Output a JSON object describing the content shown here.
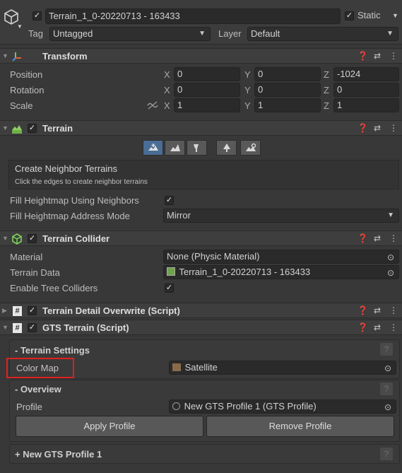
{
  "object": {
    "name": "Terrain_1_0-20220713 - 163433",
    "static_label": "Static",
    "tag_label": "Tag",
    "tag_value": "Untagged",
    "layer_label": "Layer",
    "layer_value": "Default"
  },
  "transform": {
    "title": "Transform",
    "position_label": "Position",
    "rotation_label": "Rotation",
    "scale_label": "Scale",
    "axis_x": "X",
    "axis_y": "Y",
    "axis_z": "Z",
    "position": {
      "x": "0",
      "y": "0",
      "z": "-1024"
    },
    "rotation": {
      "x": "0",
      "y": "0",
      "z": "0"
    },
    "scale": {
      "x": "1",
      "y": "1",
      "z": "1"
    }
  },
  "terrain": {
    "title": "Terrain",
    "tools": [
      "raise-lower-terrain-icon",
      "paint-terrain-icon",
      "paint-trees-icon",
      "paint-details-icon",
      "terrain-settings-icon"
    ],
    "tool_name": "Create Neighbor Terrains",
    "tool_hint": "Click the edges to create neighbor terrains",
    "fill_heightmap_label": "Fill Heightmap Using Neighbors",
    "address_mode_label": "Fill Heightmap Address Mode",
    "address_mode_value": "Mirror"
  },
  "terrain_collider": {
    "title": "Terrain Collider",
    "material_label": "Material",
    "material_value": "None (Physic Material)",
    "terrain_data_label": "Terrain Data",
    "terrain_data_value": "Terrain_1_0-20220713 - 163433",
    "tree_colliders_label": "Enable Tree Colliders"
  },
  "detail_overwrite": {
    "title": "Terrain Detail Overwrite (Script)"
  },
  "gts_terrain": {
    "title": "GTS Terrain (Script)",
    "settings_header": "- Terrain Settings",
    "color_map_label": "Color Map",
    "color_map_value": "Satellite",
    "overview_header": "- Overview",
    "profile_label": "Profile",
    "profile_value": "New GTS Profile 1 (GTS Profile)",
    "apply_button": "Apply Profile",
    "remove_button": "Remove Profile",
    "new_profile_header": "+ New GTS Profile 1",
    "help_glyph": "?"
  },
  "glyphs": {
    "check": "✓",
    "dropdown": "▼",
    "fold_open": "▼",
    "fold_closed": "▶",
    "help": "❓",
    "presets": "⇄",
    "menu": "⋮",
    "picker": "⊙"
  },
  "colors": {
    "highlight_box": "#e02020",
    "selected_tool": "#4a6d96"
  }
}
